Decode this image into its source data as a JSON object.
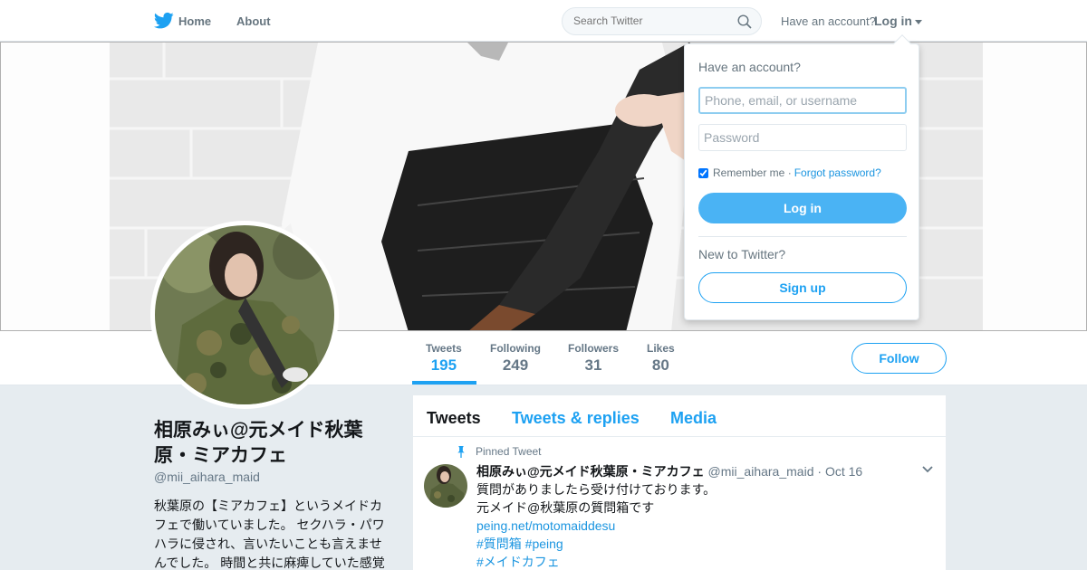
{
  "nav": {
    "logo_icon": "twitter-bird-icon",
    "home_label": "Home",
    "about_label": "About",
    "search_placeholder": "Search Twitter",
    "have_account": "Have an account?",
    "login_label": "Log in"
  },
  "profile": {
    "name": "相原みぃ@元メイド秋葉原・ミアカフェ",
    "handle": "@mii_aihara_maid",
    "bio": "秋葉原の【ミアカフェ】というメイドカフェで働いていました。 セクハラ・パワハラに侵され、言いたいことも言えませんでした。 時間と共に麻痺していた感覚"
  },
  "stats": [
    {
      "label": "Tweets",
      "value": "195"
    },
    {
      "label": "Following",
      "value": "249"
    },
    {
      "label": "Followers",
      "value": "31"
    },
    {
      "label": "Likes",
      "value": "80"
    }
  ],
  "follow_label": "Follow",
  "timeline": {
    "tabs": [
      "Tweets",
      "Tweets & replies",
      "Media"
    ],
    "pinned_label": "Pinned Tweet",
    "tweet": {
      "name": "相原みぃ@元メイド秋葉原・ミアカフェ",
      "handle": "@mii_aihara_maid",
      "time": "Oct 16",
      "lines": [
        "質問がありましたら受け付けております。",
        "元メイド@秋葉原の質問箱です"
      ],
      "link": "peing.net/motomaiddesu",
      "hashtags1": "#質問箱 #peing",
      "hashtags2": "#メイドカフェ"
    }
  },
  "login_dropdown": {
    "title": "Have an account?",
    "username_placeholder": "Phone, email, or username",
    "password_placeholder": "Password",
    "remember_label": "Remember me",
    "separator": "·",
    "forgot_label": "Forgot password?",
    "login_button": "Log in",
    "new_label": "New to Twitter?",
    "signup_button": "Sign up"
  },
  "colors": {
    "accent": "#1da1f2",
    "login_button": "#4ab3f4",
    "background": "#e6ecf0"
  }
}
